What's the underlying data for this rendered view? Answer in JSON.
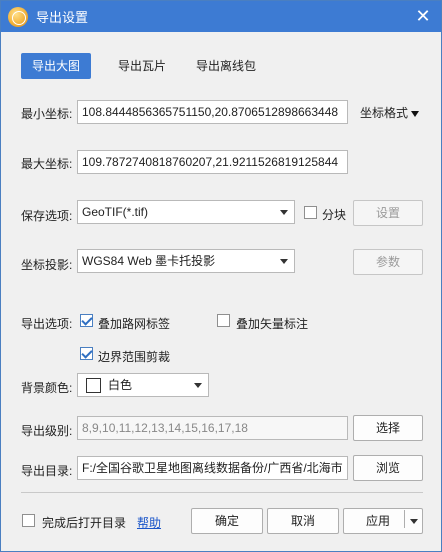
{
  "window": {
    "title": "导出设置",
    "close_glyph": "✕"
  },
  "tabs": [
    {
      "label": "导出大图"
    },
    {
      "label": "导出瓦片"
    },
    {
      "label": "导出离线包"
    }
  ],
  "min_coord": {
    "label": "最小坐标:",
    "value": "108.8444856365751150,20.8706512898663448"
  },
  "coord_format": {
    "label": "坐标格式"
  },
  "max_coord": {
    "label": "最大坐标:",
    "value": "109.7872740818760207,21.9211526819125844"
  },
  "save_option": {
    "label": "保存选项:",
    "value": "GeoTIF(*.tif)",
    "split_label": "分块",
    "settings_label": "设置"
  },
  "projection": {
    "label": "坐标投影:",
    "value": "WGS84 Web 墨卡托投影",
    "params_label": "参数"
  },
  "export_options": {
    "label": "导出选项:",
    "overlay_road_label": "叠加路网标签",
    "overlay_vector_label": "叠加矢量标注",
    "clip_boundary_label": "边界范围剪裁"
  },
  "background": {
    "label": "背景颜色:",
    "value": "白色"
  },
  "levels": {
    "label": "导出级别:",
    "value": "8,9,10,11,12,13,14,15,16,17,18",
    "select_label": "选择"
  },
  "directory": {
    "label": "导出目录:",
    "value": "F:/全国谷歌卫星地图离线数据备份/广西省/北海市",
    "browse_label": "浏览"
  },
  "footer": {
    "open_dir_label": "完成后打开目录",
    "help_label": "帮助",
    "ok_label": "确定",
    "cancel_label": "取消",
    "apply_label": "应用"
  },
  "colors": {
    "titlebar": "#3d7bd3",
    "accent": "#3d7bd3",
    "link": "#1a55c9"
  }
}
